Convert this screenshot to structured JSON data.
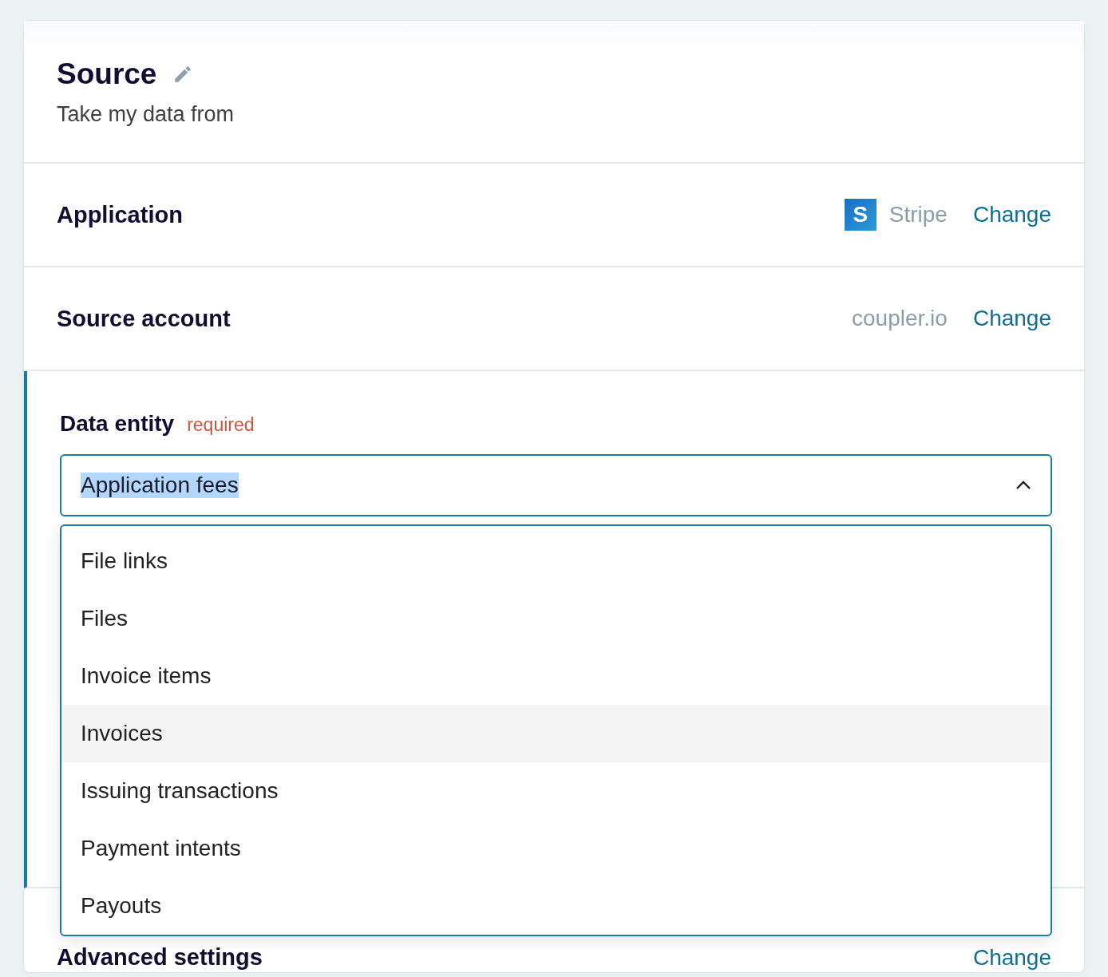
{
  "header": {
    "title": "Source",
    "subtitle": "Take my data from"
  },
  "rows": [
    {
      "kind": "app",
      "label": "Application",
      "value": "Stripe",
      "logo_letter": "S",
      "action": "Change"
    },
    {
      "kind": "plain",
      "label": "Source account",
      "value": "coupler.io",
      "action": "Change"
    }
  ],
  "data_entity": {
    "label": "Data entity",
    "required": "required",
    "value": "Application fees",
    "value_selected": true,
    "expanded": true,
    "options": [
      {
        "label": "File links",
        "selected": false,
        "highlighted": false
      },
      {
        "label": "Files",
        "selected": false,
        "highlighted": false
      },
      {
        "label": "Invoice items",
        "selected": false,
        "highlighted": false
      },
      {
        "label": "Invoices",
        "selected": false,
        "highlighted": true
      },
      {
        "label": "Issuing transactions",
        "selected": false,
        "highlighted": false
      },
      {
        "label": "Payment intents",
        "selected": false,
        "highlighted": false
      },
      {
        "label": "Payouts",
        "selected": false,
        "highlighted": false
      }
    ]
  },
  "advanced": {
    "label": "Advanced settings",
    "action": "Change"
  }
}
